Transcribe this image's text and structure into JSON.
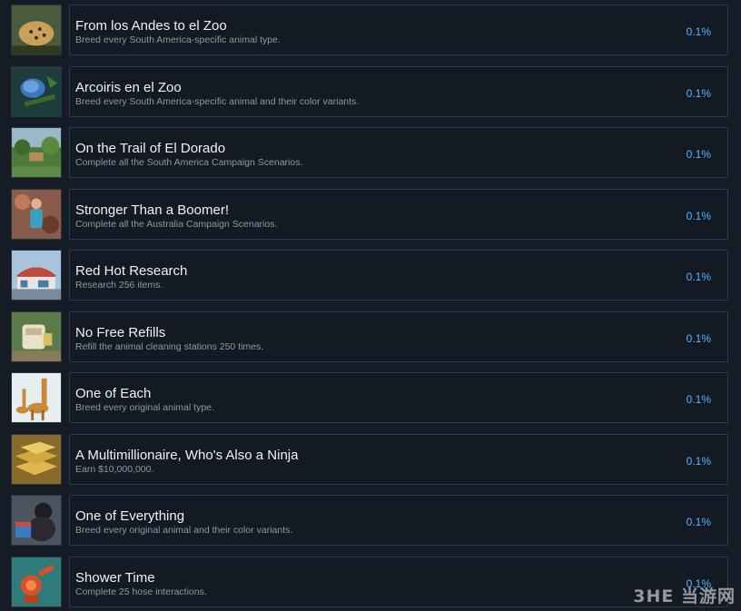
{
  "achievements": [
    {
      "title": "From los Andes to el Zoo",
      "description": "Breed every South America-specific animal type.",
      "percent": "0.1%",
      "icon": "jaguar-icon"
    },
    {
      "title": "Arcoiris en el Zoo",
      "description": "Breed every South America-specific animal and their color variants.",
      "percent": "0.1%",
      "icon": "bird-icon"
    },
    {
      "title": "On the Trail of El Dorado",
      "description": "Complete all the South America Campaign Scenarios.",
      "percent": "0.1%",
      "icon": "jungle-icon"
    },
    {
      "title": "Stronger Than a Boomer!",
      "description": "Complete all the Australia Campaign Scenarios.",
      "percent": "0.1%",
      "icon": "zookeeper-icon"
    },
    {
      "title": "Red Hot Research",
      "description": "Research 256 items.",
      "percent": "0.1%",
      "icon": "building-icon"
    },
    {
      "title": "No Free Refills",
      "description": "Refill the animal cleaning stations 250 times.",
      "percent": "0.1%",
      "icon": "cleaning-station-icon"
    },
    {
      "title": "One of Each",
      "description": "Breed every original animal type.",
      "percent": "0.1%",
      "icon": "giraffe-icon"
    },
    {
      "title": "A Multimillionaire, Who's Also a Ninja",
      "description": "Earn $10,000,000.",
      "percent": "0.1%",
      "icon": "gold-bars-icon"
    },
    {
      "title": "One of Everything",
      "description": "Breed every original animal and their color variants.",
      "percent": "0.1%",
      "icon": "gorilla-icon"
    },
    {
      "title": "Shower Time",
      "description": "Complete 25 hose interactions.",
      "percent": "0.1%",
      "icon": "hose-icon"
    }
  ],
  "watermark": "3HE 当游网",
  "colors": {
    "background": "#161c26",
    "card_border": "#2f3b4c",
    "title": "#eef2f6",
    "description": "#8f98a3",
    "percent": "#59b3ff"
  }
}
